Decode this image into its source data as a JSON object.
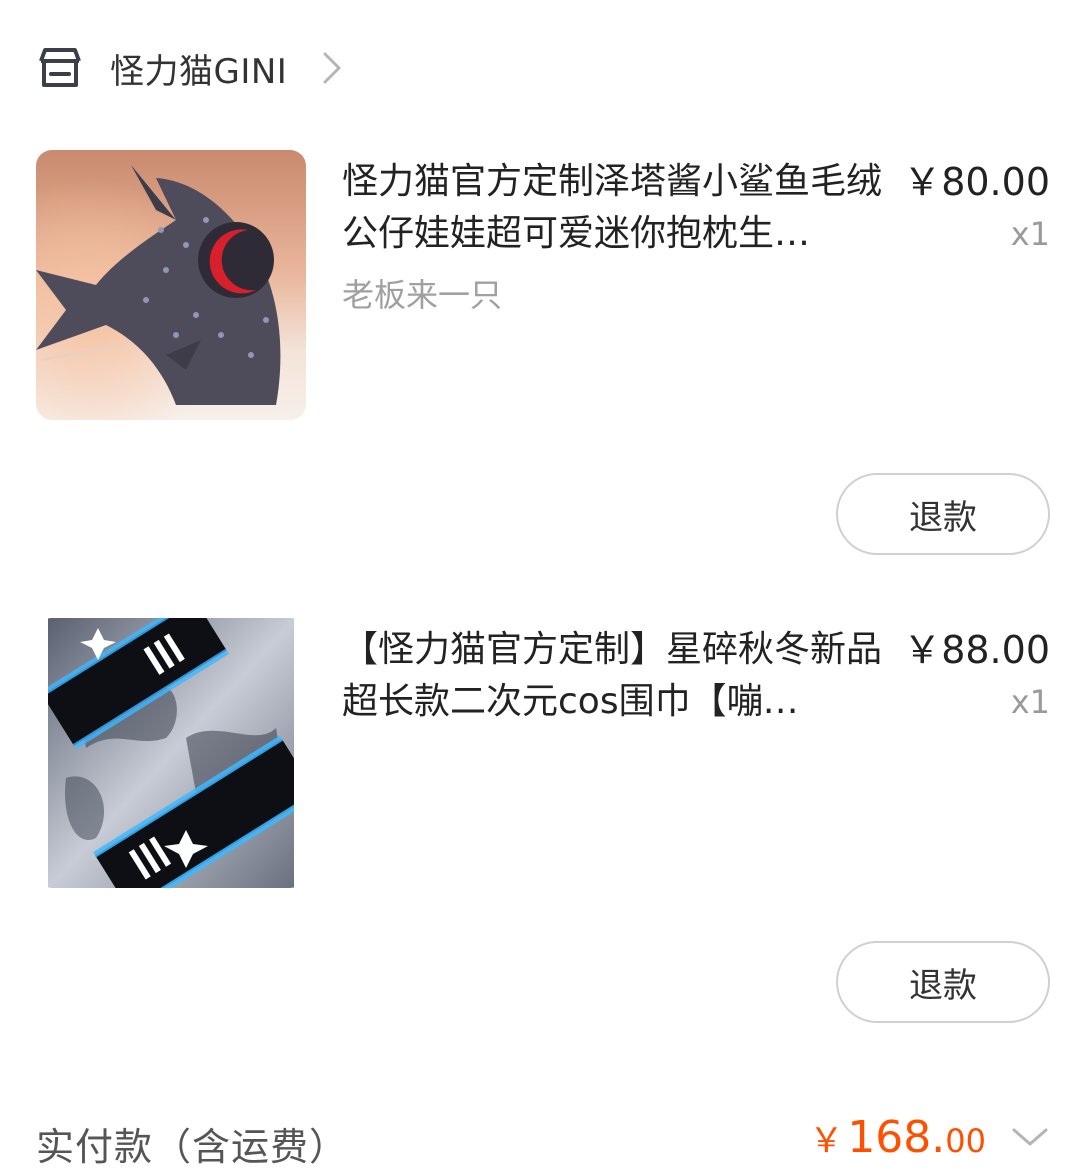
{
  "shop": {
    "name": "怪力猫GINI",
    "icon": "store-icon",
    "chevron_icon": "chevron-right-icon"
  },
  "products": [
    {
      "title": "怪力猫官方定制泽塔酱小鲨鱼毛绒公仔娃娃超可爱迷你抱枕生…",
      "sku": "老板来一只",
      "price": "￥80.00",
      "quantity": "x1",
      "image": "shark-plush-image",
      "refund_label": "退款"
    },
    {
      "title": "【怪力猫官方定制】星碎秋冬新品超长款二次元cos围巾【嘣…",
      "sku": "",
      "price": "￥88.00",
      "quantity": "x1",
      "image": "scarf-image",
      "refund_label": "退款"
    }
  ],
  "total": {
    "label": "实付款（含运费）",
    "currency": "￥",
    "amount_int": "168.",
    "amount_dec": "00",
    "chevron_icon": "chevron-down-icon"
  },
  "colors": {
    "accent": "#ff5000",
    "text_primary": "#222222",
    "text_secondary": "#9a9a9a",
    "button_border": "#d0d0d0"
  }
}
